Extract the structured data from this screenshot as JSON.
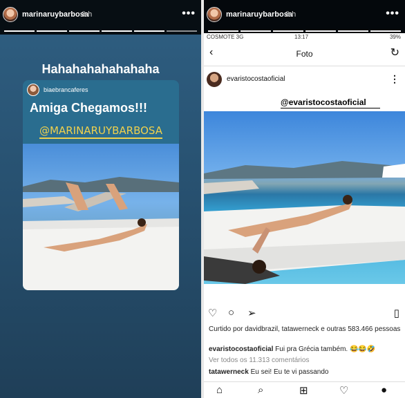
{
  "left_story": {
    "username": "marinaruybarbosa",
    "time": "3 h",
    "more": "•••",
    "caption": "Hahahahahahahaha",
    "card": {
      "username": "biaebrancaferes",
      "title": "Amiga Chegamos!!!",
      "mention": "@MARINARUYBARBOSA"
    }
  },
  "right_story": {
    "username": "marinaruybarbosa",
    "time": "3 h",
    "more": "•••",
    "status": {
      "carrier": "COSMOTE 3G",
      "time": "13:17",
      "battery": "39%"
    },
    "header": {
      "back": "‹",
      "title": "Foto",
      "refresh": "↻"
    },
    "post": {
      "username": "evaristocostaoficial",
      "more": "⋮",
      "mention": "@evaristocostaoficial",
      "liked_by": "Curtido por davidbrazil, tatawerneck e outras 583.466 pessoas",
      "comment1_user": "evaristocostaoficial",
      "comment1_text": "Fui pra Grécia também. 😂😂🤣",
      "view_all": "Ver todos os 11.313 comentários",
      "comment2_user": "tatawerneck",
      "comment2_text": "Eu sei! Eu te vi passando"
    }
  }
}
